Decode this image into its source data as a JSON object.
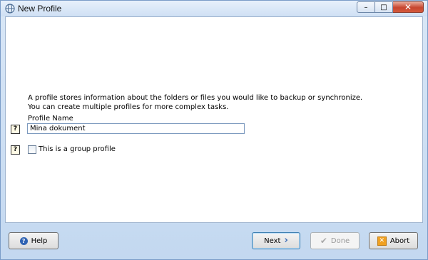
{
  "window": {
    "title": "New Profile",
    "controls": {
      "minimize": "–",
      "maximize": "□",
      "close": "✕"
    }
  },
  "content": {
    "intro_line1": "A profile stores information about the folders or files you would like to backup or synchronize.",
    "intro_line2": "You can create multiple profiles for more complex tasks.",
    "profile_name_label": "Profile Name",
    "profile_name_value": "Mina dokument",
    "group_profile_label": "This is a group profile",
    "group_profile_checked": false,
    "help_marker": "?"
  },
  "buttons": {
    "help": "Help",
    "next": "Next",
    "done": "Done",
    "abort": "Abort"
  },
  "icons": {
    "app": "sync-globe-icon",
    "help": "help-icon",
    "next": "chevron-right-icon",
    "done": "checkmark-icon",
    "abort": "abort-x-icon"
  }
}
